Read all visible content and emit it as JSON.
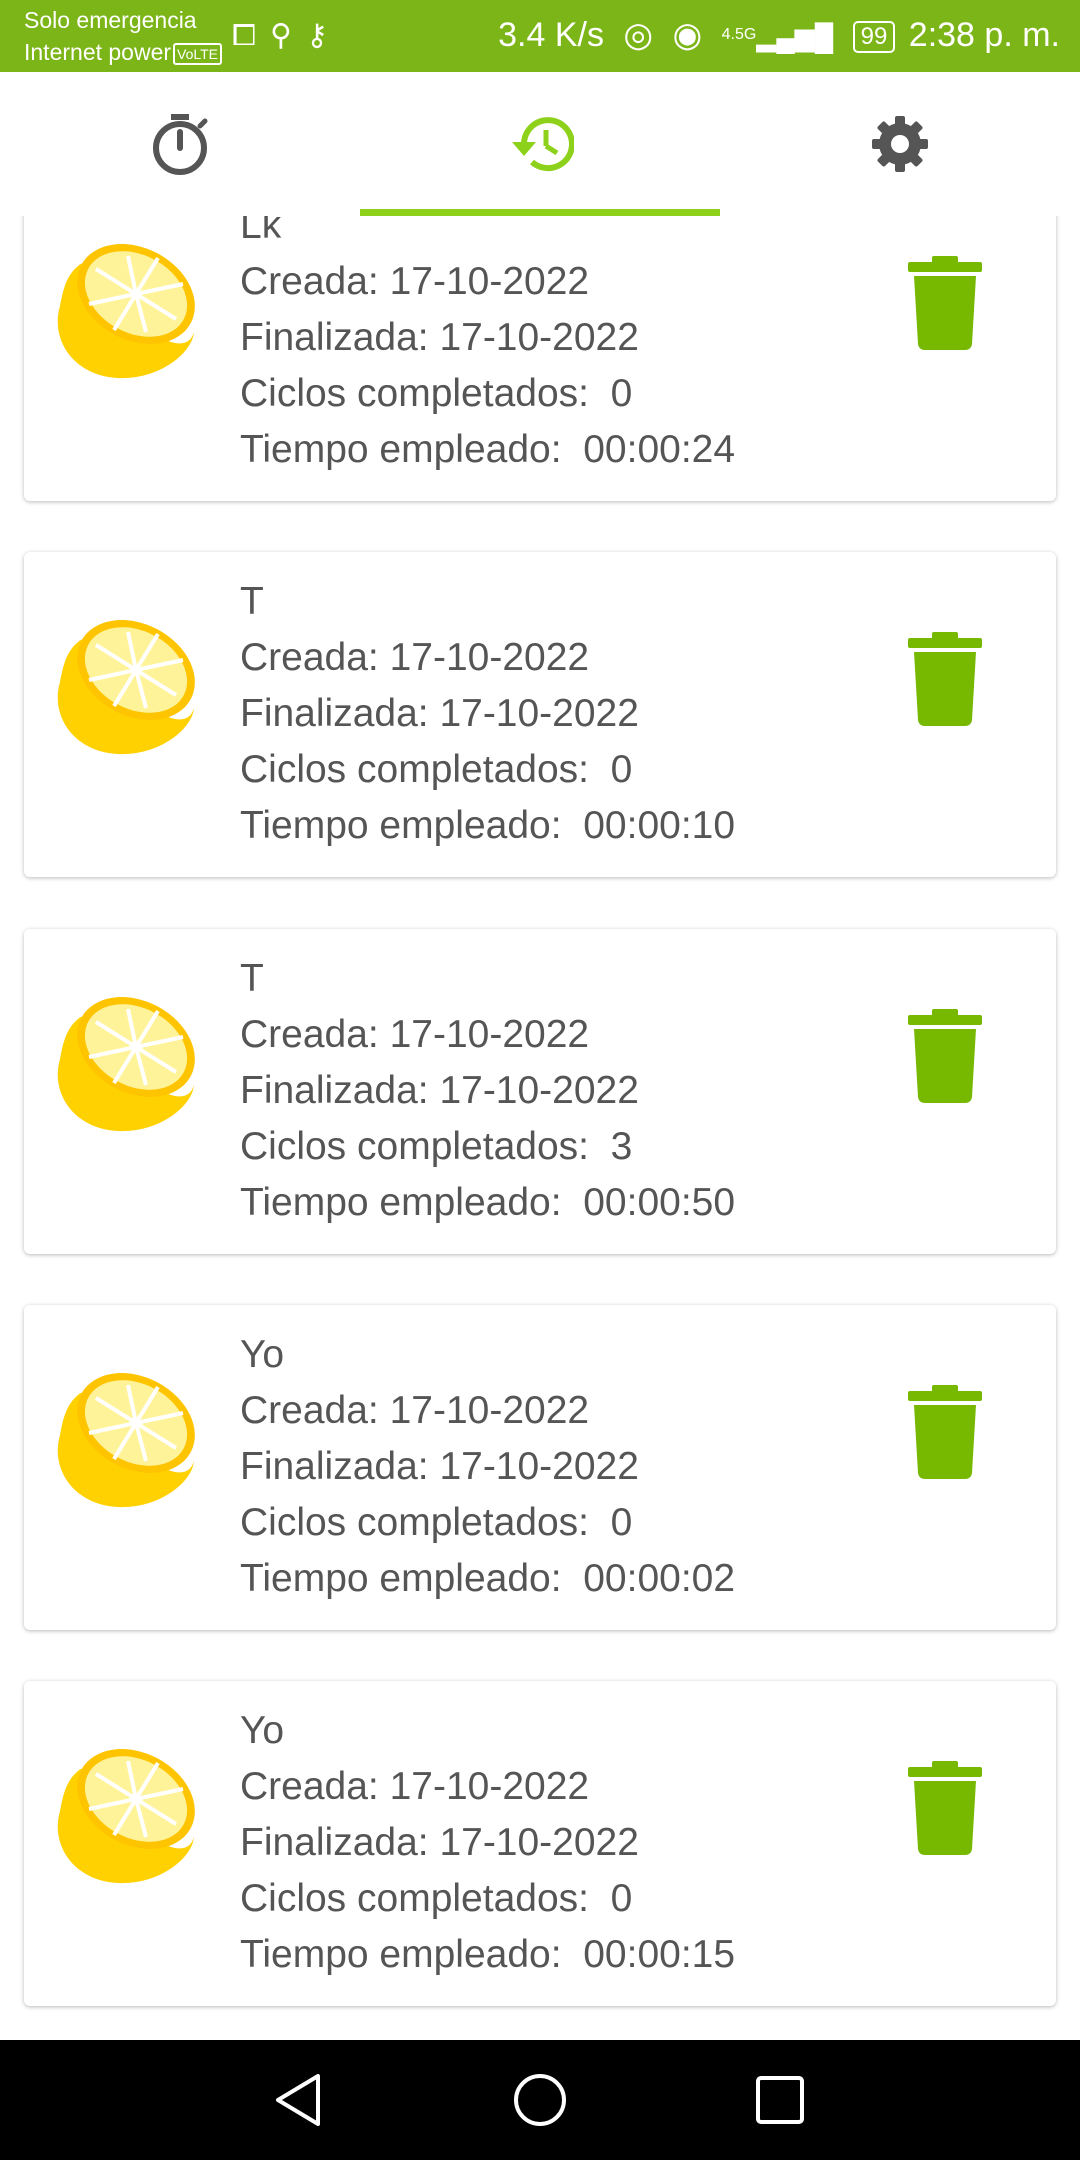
{
  "status_bar": {
    "carrier_line1": "Solo emergencia",
    "carrier_line2": "Internet power",
    "volte": "VoLTE",
    "speed": "3.4 K/s",
    "signal_label": "4.5G",
    "battery": "99",
    "time": "2:38 p. m."
  },
  "tabs": [
    {
      "icon": "timer-icon"
    },
    {
      "icon": "history-icon",
      "active": true
    },
    {
      "icon": "settings-icon"
    }
  ],
  "colors": {
    "accent": "#7cb518",
    "indicator": "#8ed11a",
    "lemon": "#ffd100",
    "trash": "#76b900"
  },
  "labels": {
    "created": "Creada: ",
    "finished": "Finalizada: ",
    "cycles": "Ciclos completados:  ",
    "time_spent": "Tiempo empleado:  "
  },
  "records": [
    {
      "name": "Lk",
      "created": "17-10-2022",
      "finished": "17-10-2022",
      "cycles": "0",
      "time": "00:00:24"
    },
    {
      "name": "T",
      "created": "17-10-2022",
      "finished": "17-10-2022",
      "cycles": "0",
      "time": "00:00:10"
    },
    {
      "name": "T",
      "created": "17-10-2022",
      "finished": "17-10-2022",
      "cycles": "3",
      "time": "00:00:50"
    },
    {
      "name": "Yo",
      "created": "17-10-2022",
      "finished": "17-10-2022",
      "cycles": "0",
      "time": "00:00:02"
    },
    {
      "name": "Yo",
      "created": "17-10-2022",
      "finished": "17-10-2022",
      "cycles": "0",
      "time": "00:00:15"
    }
  ],
  "nav": [
    {
      "icon": "back-icon"
    },
    {
      "icon": "home-icon"
    },
    {
      "icon": "recents-icon"
    }
  ]
}
